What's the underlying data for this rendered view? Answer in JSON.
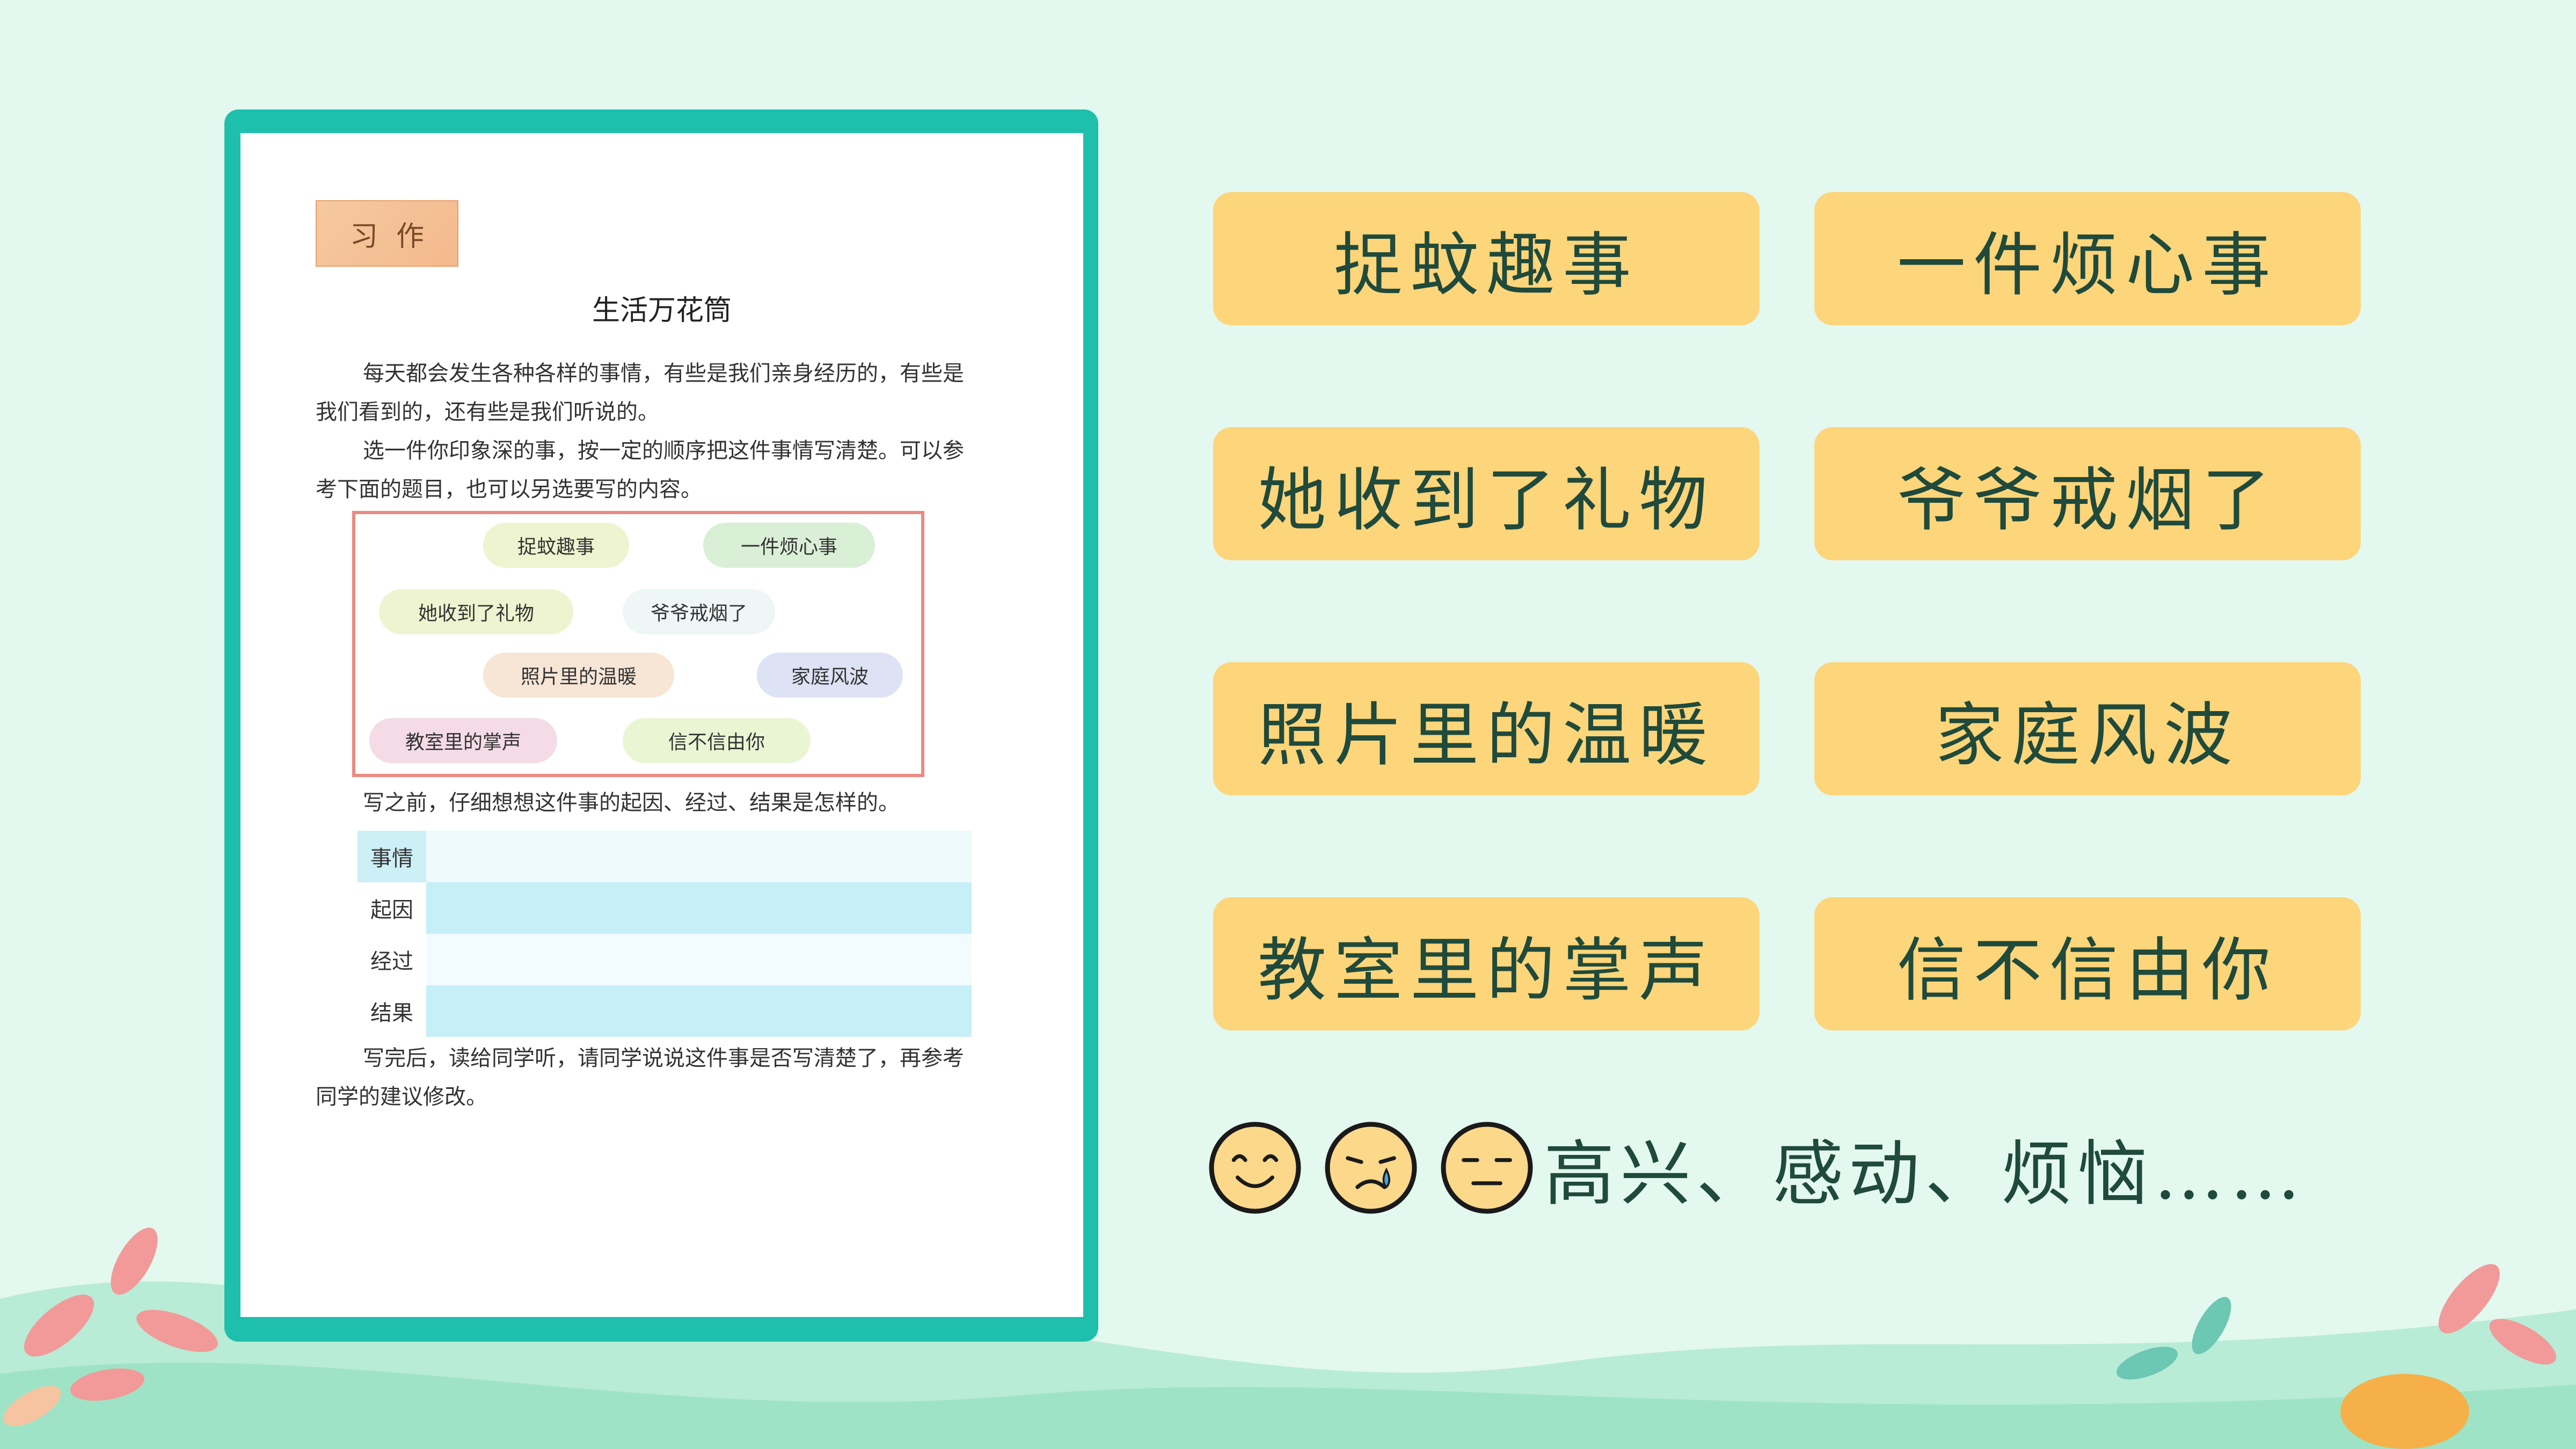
{
  "textbook": {
    "section_tag": "习作",
    "title": "生活万花筒",
    "paragraph1": "每天都会发生各种各样的事情，有些是我们亲身经历的，有些是我们看到的，还有些是我们听说的。",
    "paragraph2": "选一件你印象深的事，按一定的顺序把这件事情写清楚。可以参考下面的题目，也可以另选要写的内容。",
    "topic_chips": [
      "捉蚊趣事",
      "一件烦心事",
      "她收到了礼物",
      "爷爷戒烟了",
      "照片里的温暖",
      "家庭风波",
      "教室里的掌声",
      "信不信由你"
    ],
    "paragraph3": "写之前，仔细想想这件事的起因、经过、结果是怎样的。",
    "table_rows": [
      "事情",
      "起因",
      "经过",
      "结果"
    ],
    "paragraph4": "写完后，读给同学听，请同学说说这件事是否写清楚了，再参考同学的建议修改。"
  },
  "topics": [
    "捉蚊趣事",
    "一件烦心事",
    "她收到了礼物",
    "爷爷戒烟了",
    "照片里的温暖",
    "家庭风波",
    "教室里的掌声",
    "信不信由你"
  ],
  "emotions": {
    "icons": [
      "smile-face-icon",
      "crying-face-icon",
      "annoyed-face-icon"
    ],
    "text": "高兴、感动、烦恼……"
  },
  "colors": {
    "background": "#e3f8ef",
    "frame": "#1fbfad",
    "button": "#fdd57a",
    "button_text": "#1f4a3c",
    "highlight_border": "#ec8a82"
  }
}
